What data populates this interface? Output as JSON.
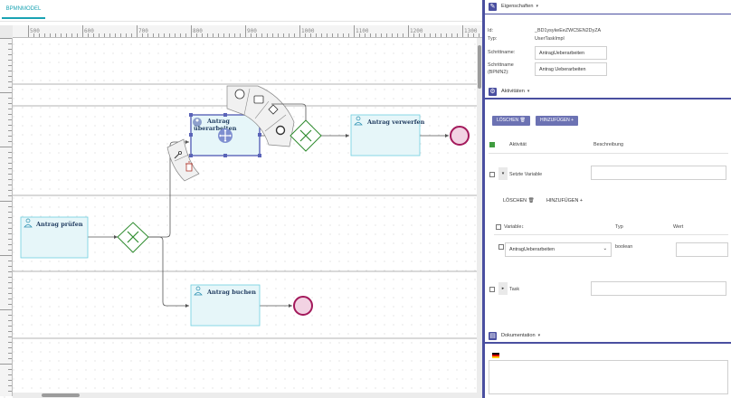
{
  "tabs": [
    {
      "label": "BPMNMODEL"
    }
  ],
  "ruler": {
    "labels": [
      "500",
      "600",
      "700",
      "800",
      "900",
      "1000",
      "1100",
      "1200",
      "1300"
    ]
  },
  "diagram": {
    "tasks": {
      "pruefen": "Antrag prüfen",
      "ueberarbeiten_1": "Antrag",
      "ueberarbeiten_2": "überarbeiten",
      "verwerfen": "Antrag verwerfen",
      "buchen": "Antrag buchen"
    }
  },
  "panel": {
    "properties": {
      "title": "Eigenschaften",
      "id_label": "Id:",
      "id_value": "_BD1ysykeEeZWC5EN2DyZA",
      "type_label": "Typ:",
      "type_value": "UserTaskImpl",
      "stepname_label": "Schrittname:",
      "stepname_value": "AntragUeberarbeiten",
      "stepname_bpmn_label_1": "Schrittname",
      "stepname_bpmn_label_2": "(BPMN2):",
      "stepname_bpmn_value": "Antrag Ueberarbeiten"
    },
    "activities": {
      "title": "Aktivitäten",
      "delete_btn": "LÖSCHEN",
      "add_btn": "HINZUFÜGEN",
      "col_activity": "Aktivität",
      "col_description": "Beschreibung",
      "row_setvar": "Setzte Variable",
      "sub_delete": "LÖSCHEN",
      "sub_add": "HINZUFÜGEN",
      "col_variable": "Variable",
      "col_type": "Typ",
      "col_value": "Wert",
      "var_select": "AntragUeberarbeiten",
      "var_type": "boolean",
      "row_task": "Task"
    },
    "documentation": {
      "title": "Dokumentation"
    }
  },
  "colors": {
    "accent": "#4a4fa0",
    "tab": "#1aa3b3",
    "task_fill": "#e6f6f9",
    "task_stroke": "#6fcfe0",
    "gateway": "#2e8b2e",
    "end_event": "#a3195b"
  }
}
